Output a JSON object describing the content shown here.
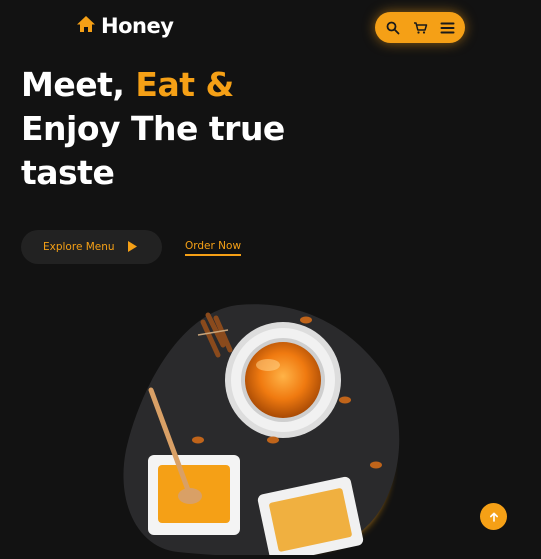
{
  "brand": {
    "name": "Honey",
    "icon": "home-icon"
  },
  "header": {
    "icons": [
      "search-icon",
      "cart-icon",
      "menu-icon"
    ]
  },
  "hero": {
    "line1_part1": "Meet,",
    "line1_accent": "Eat &",
    "line2": "Enjoy The true",
    "line3": "taste"
  },
  "buttons": {
    "explore_label": "Explore Menu",
    "order_label": "Order Now"
  },
  "scroll_top": {
    "icon": "arrow-up-icon"
  },
  "colors": {
    "accent": "#f5a016",
    "background": "#121212",
    "button_bg": "#222222"
  }
}
